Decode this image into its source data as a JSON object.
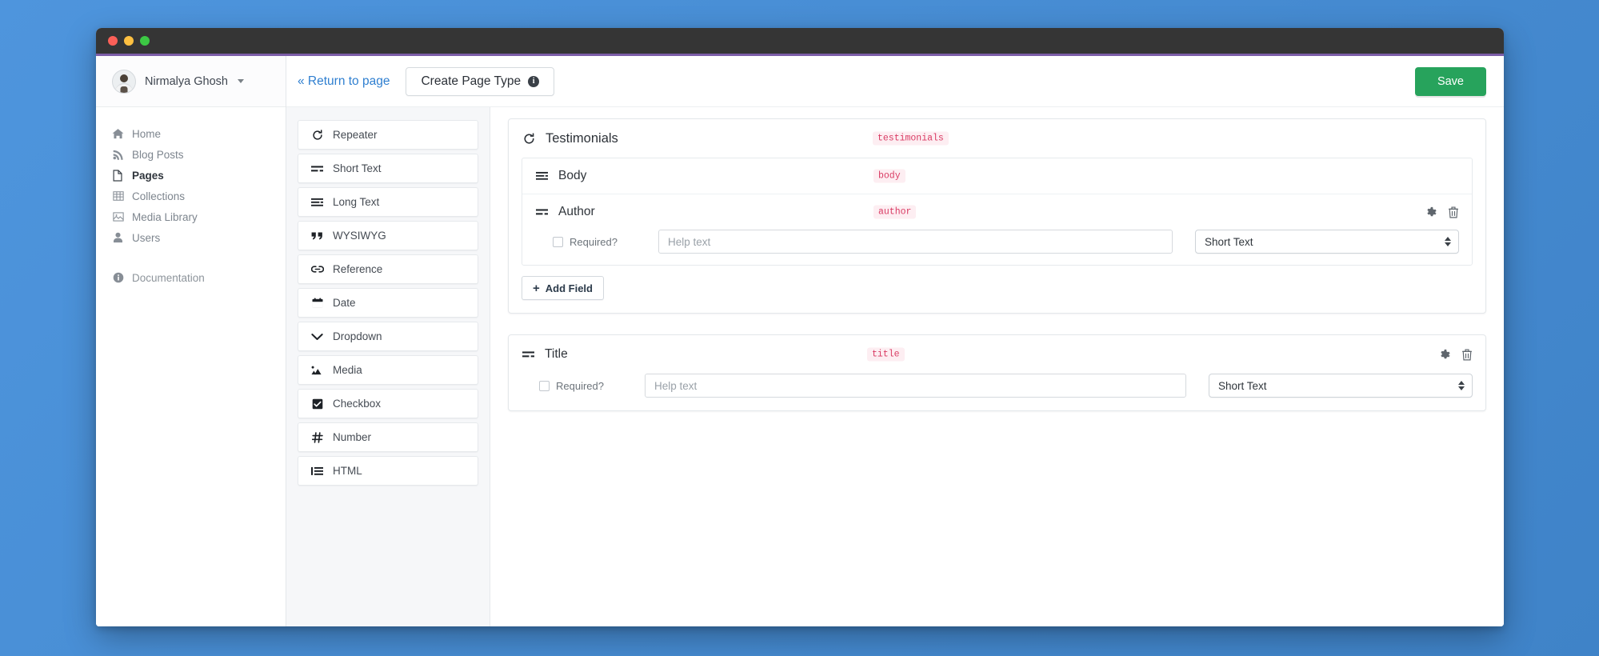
{
  "window": {
    "traffic_lights": [
      "close",
      "minimize",
      "maximize"
    ]
  },
  "sidebar": {
    "user": {
      "name": "Nirmalya Ghosh",
      "avatar_icon": "user-avatar"
    },
    "items": [
      {
        "label": "Home",
        "icon": "home-icon",
        "active": false
      },
      {
        "label": "Blog Posts",
        "icon": "rss-icon",
        "active": false
      },
      {
        "label": "Pages",
        "icon": "file-icon",
        "active": true
      },
      {
        "label": "Collections",
        "icon": "table-icon",
        "active": false
      },
      {
        "label": "Media Library",
        "icon": "image-icon",
        "active": false
      },
      {
        "label": "Users",
        "icon": "user-icon",
        "active": false
      }
    ],
    "documentation": {
      "label": "Documentation",
      "icon": "info-icon"
    }
  },
  "topbar": {
    "return_link": "« Return to page",
    "tab_label": "Create Page Type",
    "tab_info_icon": "info-icon",
    "save_label": "Save",
    "save_color": "#27a35c"
  },
  "palette": {
    "items": [
      {
        "label": "Repeater",
        "icon": "repeat-icon"
      },
      {
        "label": "Short Text",
        "icon": "short-text-icon"
      },
      {
        "label": "Long Text",
        "icon": "long-text-icon"
      },
      {
        "label": "WYSIWYG",
        "icon": "quote-icon"
      },
      {
        "label": "Reference",
        "icon": "link-icon"
      },
      {
        "label": "Date",
        "icon": "calendar-icon"
      },
      {
        "label": "Dropdown",
        "icon": "chevron-down-icon"
      },
      {
        "label": "Media",
        "icon": "image-icon"
      },
      {
        "label": "Checkbox",
        "icon": "checkbox-icon"
      },
      {
        "label": "Number",
        "icon": "hash-icon"
      },
      {
        "label": "HTML",
        "icon": "list-icon"
      }
    ]
  },
  "canvas": {
    "repeater": {
      "title": "Testimonials",
      "slug": "testimonials",
      "icon": "repeat-icon",
      "fields": [
        {
          "name": "Body",
          "slug": "body",
          "icon": "long-text-icon",
          "expanded": false
        },
        {
          "name": "Author",
          "slug": "author",
          "icon": "short-text-icon",
          "expanded": true,
          "required_label": "Required?",
          "required_checked": false,
          "help_placeholder": "Help text",
          "help_value": "",
          "type_value": "Short Text",
          "gear_icon": "gear-icon",
          "trash_icon": "trash-icon"
        }
      ],
      "add_field_label": "Add Field"
    },
    "title_field": {
      "name": "Title",
      "slug": "title",
      "icon": "short-text-icon",
      "required_label": "Required?",
      "required_checked": false,
      "help_placeholder": "Help text",
      "help_value": "",
      "type_value": "Short Text",
      "gear_icon": "gear-icon",
      "trash_icon": "trash-icon"
    }
  },
  "colors": {
    "desktop": "#4a90d9",
    "titlebar": "#353535",
    "accent_line": "#7c5da8",
    "slug_text": "#d93b63",
    "slug_bg": "#fdeef2",
    "link": "#2f7fd0"
  }
}
